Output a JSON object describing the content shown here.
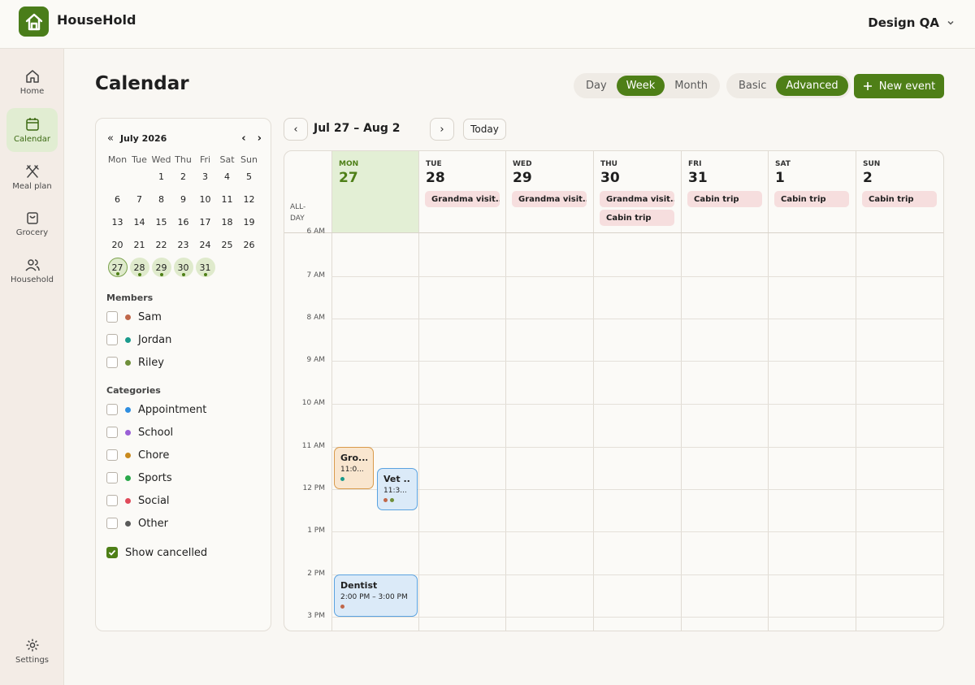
{
  "app": {
    "name": "HouseHold",
    "account": "Design QA"
  },
  "nav": [
    {
      "label": "Home",
      "icon": "home-icon",
      "active": false
    },
    {
      "label": "Calendar",
      "icon": "calendar-icon",
      "active": true
    },
    {
      "label": "Meal plan",
      "icon": "utensils-icon",
      "active": false
    },
    {
      "label": "Grocery",
      "icon": "shopping-bag-icon",
      "active": false
    },
    {
      "label": "Household",
      "icon": "users-icon",
      "active": false
    }
  ],
  "settings_label": "Settings",
  "page_title": "Calendar",
  "view_modes": [
    {
      "label": "Day",
      "active": false
    },
    {
      "label": "Week",
      "active": true
    },
    {
      "label": "Month",
      "active": false
    }
  ],
  "complexity_modes": [
    {
      "label": "Basic",
      "active": false
    },
    {
      "label": "Advanced",
      "active": true
    }
  ],
  "new_event_label": "New event",
  "mini_calendar": {
    "month_label": "July 2026",
    "weekdays": [
      "Mon",
      "Tue",
      "Wed",
      "Thu",
      "Fri",
      "Sat",
      "Sun"
    ],
    "weeks": [
      [
        "",
        "",
        "1",
        "2",
        "3",
        "4",
        "5"
      ],
      [
        "6",
        "7",
        "8",
        "9",
        "10",
        "11",
        "12"
      ],
      [
        "13",
        "14",
        "15",
        "16",
        "17",
        "18",
        "19"
      ],
      [
        "20",
        "21",
        "22",
        "23",
        "24",
        "25",
        "26"
      ],
      [
        "27",
        "28",
        "29",
        "30",
        "31",
        "",
        ""
      ]
    ],
    "highlighted_days": [
      "27",
      "28",
      "29",
      "30",
      "31"
    ],
    "today": "27"
  },
  "members_title": "Members",
  "members": [
    {
      "name": "Sam",
      "color": "#c0674a"
    },
    {
      "name": "Jordan",
      "color": "#1a9a8c"
    },
    {
      "name": "Riley",
      "color": "#6f8f3a"
    }
  ],
  "categories_title": "Categories",
  "categories": [
    {
      "name": "Appointment",
      "color": "#2f8ee0"
    },
    {
      "name": "School",
      "color": "#9a5fd6"
    },
    {
      "name": "Chore",
      "color": "#c98a1e"
    },
    {
      "name": "Sports",
      "color": "#2aa84a"
    },
    {
      "name": "Social",
      "color": "#e04a5a"
    },
    {
      "name": "Other",
      "color": "#5a5a5a"
    }
  ],
  "show_cancelled": {
    "label": "Show cancelled",
    "checked": true
  },
  "week_range": "Jul 27 – Aug 2",
  "today_label": "Today",
  "all_day_label": "ALL-\nDAY",
  "days": [
    {
      "dow": "MON",
      "num": "27",
      "today": true,
      "all_day": []
    },
    {
      "dow": "TUE",
      "num": "28",
      "today": false,
      "all_day": [
        "Grandma visit..."
      ]
    },
    {
      "dow": "WED",
      "num": "29",
      "today": false,
      "all_day": [
        "Grandma visit..."
      ]
    },
    {
      "dow": "THU",
      "num": "30",
      "today": false,
      "all_day": [
        "Grandma visit...",
        "Cabin trip"
      ]
    },
    {
      "dow": "FRI",
      "num": "31",
      "today": false,
      "all_day": [
        "Cabin trip"
      ]
    },
    {
      "dow": "SAT",
      "num": "1",
      "today": false,
      "all_day": [
        "Cabin trip"
      ]
    },
    {
      "dow": "SUN",
      "num": "2",
      "today": false,
      "all_day": [
        "Cabin trip"
      ]
    }
  ],
  "hours": [
    "6 AM",
    "7 AM",
    "8 AM",
    "9 AM",
    "10 AM",
    "11 AM",
    "12 PM",
    "1 PM",
    "2 PM",
    "3 PM"
  ],
  "events": [
    {
      "title": "Gro...",
      "time": "11:0...",
      "style": "orange",
      "dots": [
        "#1a9a8c"
      ]
    },
    {
      "title": "Vet ...",
      "time": "11:3...",
      "style": "blue",
      "dots": [
        "#c0674a",
        "#6f8f3a"
      ]
    },
    {
      "title": "Dentist",
      "time": "2:00 PM – 3:00 PM",
      "style": "blue",
      "dots": [
        "#c0674a"
      ]
    }
  ]
}
